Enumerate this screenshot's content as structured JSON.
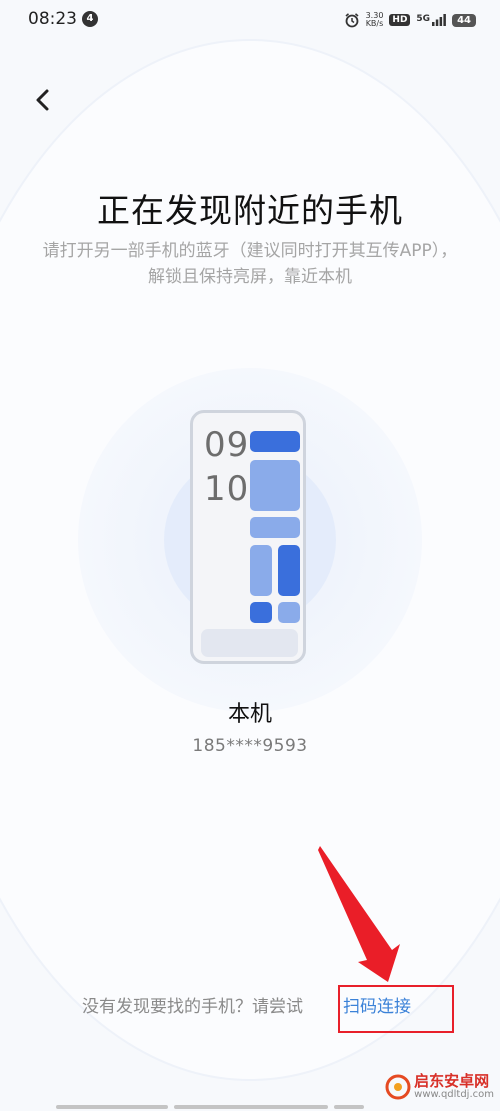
{
  "status_bar": {
    "time": "08:23",
    "notification_count": "4",
    "net_speed_value": "3.30",
    "net_speed_unit": "KB/s",
    "hd_label": "HD",
    "network_label": "5G",
    "battery": "44"
  },
  "header": {
    "title": "正在发现附近的手机",
    "subtitle": "请打开另一部手机的蓝牙（建议同时打开其互传APP），解锁且保持亮屏，靠近本机"
  },
  "device": {
    "clock_hour": "09",
    "clock_minute": "10",
    "name": "本机",
    "phone": "185****9593"
  },
  "footer": {
    "prompt": "没有发现要找的手机？请尝试",
    "scan_link": "扫码连接"
  },
  "watermark": {
    "text": "启东安卓网",
    "url": "www.qdltdj.com"
  },
  "colors": {
    "accent": "#3b82d8",
    "tile_dark": "#3a6fdc",
    "tile_light": "#8aabea",
    "highlight": "#e8202a"
  }
}
